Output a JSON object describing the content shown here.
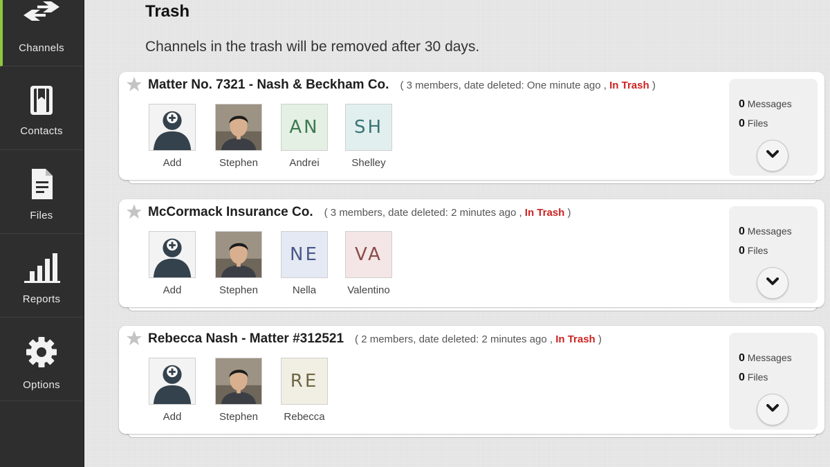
{
  "sidebar": {
    "items": [
      {
        "label": "Channels",
        "icon": "arrows-icon"
      },
      {
        "label": "Contacts",
        "icon": "contacts-book-icon"
      },
      {
        "label": "Files",
        "icon": "file-icon"
      },
      {
        "label": "Reports",
        "icon": "bar-chart-icon"
      },
      {
        "label": "Options",
        "icon": "gear-icon"
      }
    ]
  },
  "page": {
    "title": "Trash",
    "subtitle": "Channels in the trash will be removed after 30 days."
  },
  "colors": {
    "sidebar_bg": "#2e2e2e",
    "active_accent": "#8dc63f",
    "trash_red": "#cc2222"
  },
  "channels": [
    {
      "title": "Matter No. 7321 - Nash & Beckham Co.",
      "meta_prefix": "( 3 members, date deleted: One minute ago , ",
      "status": "In Trash",
      "meta_suffix": " )",
      "members": [
        {
          "name": "Add"
        },
        {
          "name": "Stephen"
        },
        {
          "name": "Andrei",
          "initials": "AN"
        },
        {
          "name": "Shelley",
          "initials": "SH"
        }
      ],
      "messages_count": "0",
      "messages_label": "Messages",
      "files_count": "0",
      "files_label": "Files"
    },
    {
      "title": "McCormack Insurance Co.",
      "meta_prefix": "( 3 members, date deleted: 2 minutes ago , ",
      "status": "In Trash",
      "meta_suffix": " )",
      "members": [
        {
          "name": "Add"
        },
        {
          "name": "Stephen"
        },
        {
          "name": "Nella",
          "initials": "NE"
        },
        {
          "name": "Valentino",
          "initials": "VA"
        }
      ],
      "messages_count": "0",
      "messages_label": "Messages",
      "files_count": "0",
      "files_label": "Files"
    },
    {
      "title": "Rebecca Nash - Matter #312521",
      "meta_prefix": "( 2 members, date deleted: 2 minutes ago , ",
      "status": "In Trash",
      "meta_suffix": " )",
      "members": [
        {
          "name": "Add"
        },
        {
          "name": "Stephen"
        },
        {
          "name": "Rebecca",
          "initials": "RE"
        }
      ],
      "messages_count": "0",
      "messages_label": "Messages",
      "files_count": "0",
      "files_label": "Files"
    }
  ]
}
